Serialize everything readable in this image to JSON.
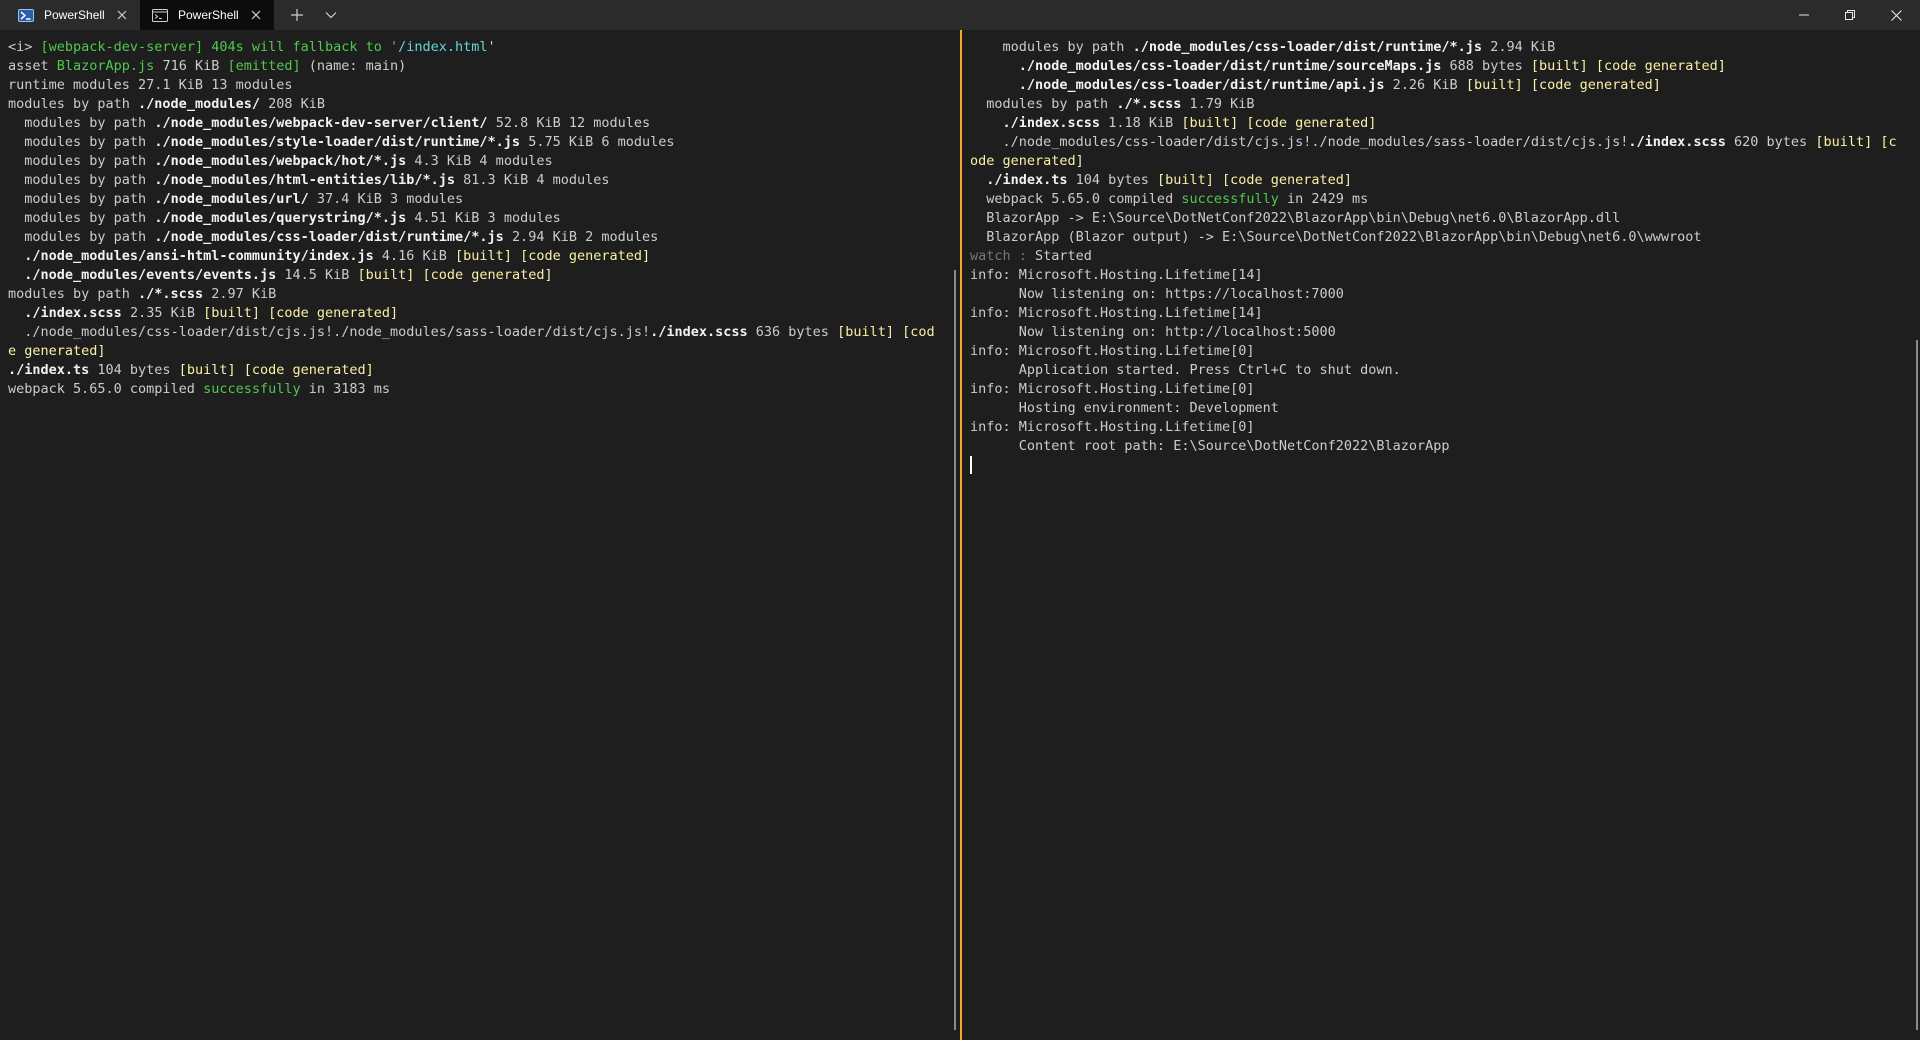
{
  "tabs": [
    {
      "label": "PowerShell",
      "icon": "powershell-icon",
      "active": false
    },
    {
      "label": "PowerShell",
      "icon": "terminal-icon",
      "active": true
    }
  ],
  "colors": {
    "accent_divider": "#f0a830",
    "green": "#4ec94e",
    "yellow": "#f9f1a5",
    "cyan": "#61d6d6",
    "text": "#cccccc",
    "background": "#1e1e1e"
  },
  "left_pane": {
    "lines": [
      [
        {
          "t": "<i> ",
          "c": "default"
        },
        {
          "t": "[webpack-dev-server] 404s will fallback to '",
          "c": "green"
        },
        {
          "t": "/index.html",
          "c": "cyan"
        },
        {
          "t": "'",
          "c": "default"
        }
      ],
      [
        {
          "t": "asset ",
          "c": "default"
        },
        {
          "t": "BlazorApp.js",
          "c": "green"
        },
        {
          "t": " 716 KiB ",
          "c": "default"
        },
        {
          "t": "[emitted]",
          "c": "green"
        },
        {
          "t": " (name: main)",
          "c": "default"
        }
      ],
      [
        {
          "t": "runtime modules 27.1 KiB 13 modules",
          "c": "default"
        }
      ],
      [
        {
          "t": "modules by path ",
          "c": "default"
        },
        {
          "t": "./node_modules/",
          "c": "bold"
        },
        {
          "t": " 208 KiB",
          "c": "default"
        }
      ],
      [
        {
          "t": "  modules by path ",
          "c": "default"
        },
        {
          "t": "./node_modules/webpack-dev-server/client/",
          "c": "bold"
        },
        {
          "t": " 52.8 KiB 12 modules",
          "c": "default"
        }
      ],
      [
        {
          "t": "  modules by path ",
          "c": "default"
        },
        {
          "t": "./node_modules/style-loader/dist/runtime/*.js",
          "c": "bold"
        },
        {
          "t": " 5.75 KiB 6 modules",
          "c": "default"
        }
      ],
      [
        {
          "t": "  modules by path ",
          "c": "default"
        },
        {
          "t": "./node_modules/webpack/hot/*.js",
          "c": "bold"
        },
        {
          "t": " 4.3 KiB 4 modules",
          "c": "default"
        }
      ],
      [
        {
          "t": "  modules by path ",
          "c": "default"
        },
        {
          "t": "./node_modules/html-entities/lib/*.js",
          "c": "bold"
        },
        {
          "t": " 81.3 KiB 4 modules",
          "c": "default"
        }
      ],
      [
        {
          "t": "  modules by path ",
          "c": "default"
        },
        {
          "t": "./node_modules/url/",
          "c": "bold"
        },
        {
          "t": " 37.4 KiB 3 modules",
          "c": "default"
        }
      ],
      [
        {
          "t": "  modules by path ",
          "c": "default"
        },
        {
          "t": "./node_modules/querystring/*.js",
          "c": "bold"
        },
        {
          "t": " 4.51 KiB 3 modules",
          "c": "default"
        }
      ],
      [
        {
          "t": "  modules by path ",
          "c": "default"
        },
        {
          "t": "./node_modules/css-loader/dist/runtime/*.js",
          "c": "bold"
        },
        {
          "t": " 2.94 KiB 2 modules",
          "c": "default"
        }
      ],
      [
        {
          "t": "  ",
          "c": "default"
        },
        {
          "t": "./node_modules/ansi-html-community/index.js",
          "c": "bold"
        },
        {
          "t": " 4.16 KiB ",
          "c": "default"
        },
        {
          "t": "[built] [code generated]",
          "c": "yellow"
        }
      ],
      [
        {
          "t": "  ",
          "c": "default"
        },
        {
          "t": "./node_modules/events/events.js",
          "c": "bold"
        },
        {
          "t": " 14.5 KiB ",
          "c": "default"
        },
        {
          "t": "[built] [code generated]",
          "c": "yellow"
        }
      ],
      [
        {
          "t": "modules by path ",
          "c": "default"
        },
        {
          "t": "./*.scss",
          "c": "bold"
        },
        {
          "t": " 2.97 KiB",
          "c": "default"
        }
      ],
      [
        {
          "t": "  ",
          "c": "default"
        },
        {
          "t": "./index.scss",
          "c": "bold"
        },
        {
          "t": " 2.35 KiB ",
          "c": "default"
        },
        {
          "t": "[built] [code generated]",
          "c": "yellow"
        }
      ],
      [
        {
          "t": "  ./node_modules/css-loader/dist/cjs.js!./node_modules/sass-loader/dist/cjs.js!",
          "c": "default"
        },
        {
          "t": "./index.scss",
          "c": "bold"
        },
        {
          "t": " 636 bytes ",
          "c": "default"
        },
        {
          "t": "[built] [code generated]",
          "c": "yellow"
        }
      ],
      [
        {
          "t": "./index.ts",
          "c": "bold"
        },
        {
          "t": " 104 bytes ",
          "c": "default"
        },
        {
          "t": "[built] [code generated]",
          "c": "yellow"
        }
      ],
      [
        {
          "t": "webpack 5.65.0 compiled ",
          "c": "default"
        },
        {
          "t": "successfully",
          "c": "green"
        },
        {
          "t": " in 3183 ms",
          "c": "default"
        }
      ]
    ]
  },
  "right_pane": {
    "lines": [
      [
        {
          "t": "    modules by path ",
          "c": "default"
        },
        {
          "t": "./node_modules/css-loader/dist/runtime/*.js",
          "c": "bold"
        },
        {
          "t": " 2.94 KiB",
          "c": "default"
        }
      ],
      [
        {
          "t": "      ",
          "c": "default"
        },
        {
          "t": "./node_modules/css-loader/dist/runtime/sourceMaps.js",
          "c": "bold"
        },
        {
          "t": " 688 bytes ",
          "c": "default"
        },
        {
          "t": "[built] [code generated]",
          "c": "yellow"
        }
      ],
      [
        {
          "t": "      ",
          "c": "default"
        },
        {
          "t": "./node_modules/css-loader/dist/runtime/api.js",
          "c": "bold"
        },
        {
          "t": " 2.26 KiB ",
          "c": "default"
        },
        {
          "t": "[built] [code generated]",
          "c": "yellow"
        }
      ],
      [
        {
          "t": "  modules by path ",
          "c": "default"
        },
        {
          "t": "./*.scss",
          "c": "bold"
        },
        {
          "t": " 1.79 KiB",
          "c": "default"
        }
      ],
      [
        {
          "t": "    ",
          "c": "default"
        },
        {
          "t": "./index.scss",
          "c": "bold"
        },
        {
          "t": " 1.18 KiB ",
          "c": "default"
        },
        {
          "t": "[built] [code generated]",
          "c": "yellow"
        }
      ],
      [
        {
          "t": "    ./node_modules/css-loader/dist/cjs.js!./node_modules/sass-loader/dist/cjs.js!",
          "c": "default"
        },
        {
          "t": "./index.scss",
          "c": "bold"
        },
        {
          "t": " 620 bytes ",
          "c": "default"
        },
        {
          "t": "[built] [code generated]",
          "c": "yellow"
        }
      ],
      [
        {
          "t": "  ",
          "c": "default"
        },
        {
          "t": "./index.ts",
          "c": "bold"
        },
        {
          "t": " 104 bytes ",
          "c": "default"
        },
        {
          "t": "[built] [code generated]",
          "c": "yellow"
        }
      ],
      [
        {
          "t": "  webpack 5.65.0 compiled ",
          "c": "default"
        },
        {
          "t": "successfully",
          "c": "green"
        },
        {
          "t": " in 2429 ms",
          "c": "default"
        }
      ],
      [
        {
          "t": "  BlazorApp -> E:\\Source\\DotNetConf2022\\BlazorApp\\bin\\Debug\\net6.0\\BlazorApp.dll",
          "c": "default"
        }
      ],
      [
        {
          "t": "  BlazorApp (Blazor output) -> E:\\Source\\DotNetConf2022\\BlazorApp\\bin\\Debug\\net6.0\\wwwroot",
          "c": "default"
        }
      ],
      [
        {
          "t": "watch : ",
          "c": "gray"
        },
        {
          "t": "Started",
          "c": "default"
        }
      ],
      [
        {
          "t": "info: Microsoft.Hosting.Lifetime[14]",
          "c": "default"
        }
      ],
      [
        {
          "t": "      Now listening on: https://localhost:7000",
          "c": "default"
        }
      ],
      [
        {
          "t": "info: Microsoft.Hosting.Lifetime[14]",
          "c": "default"
        }
      ],
      [
        {
          "t": "      Now listening on: http://localhost:5000",
          "c": "default"
        }
      ],
      [
        {
          "t": "info: Microsoft.Hosting.Lifetime[0]",
          "c": "default"
        }
      ],
      [
        {
          "t": "      Application started. Press Ctrl+C to shut down.",
          "c": "default"
        }
      ],
      [
        {
          "t": "info: Microsoft.Hosting.Lifetime[0]",
          "c": "default"
        }
      ],
      [
        {
          "t": "      Hosting environment: Development",
          "c": "default"
        }
      ],
      [
        {
          "t": "info: Microsoft.Hosting.Lifetime[0]",
          "c": "default"
        }
      ],
      [
        {
          "t": "      Content root path: E:\\Source\\DotNetConf2022\\BlazorApp",
          "c": "default"
        }
      ]
    ]
  }
}
